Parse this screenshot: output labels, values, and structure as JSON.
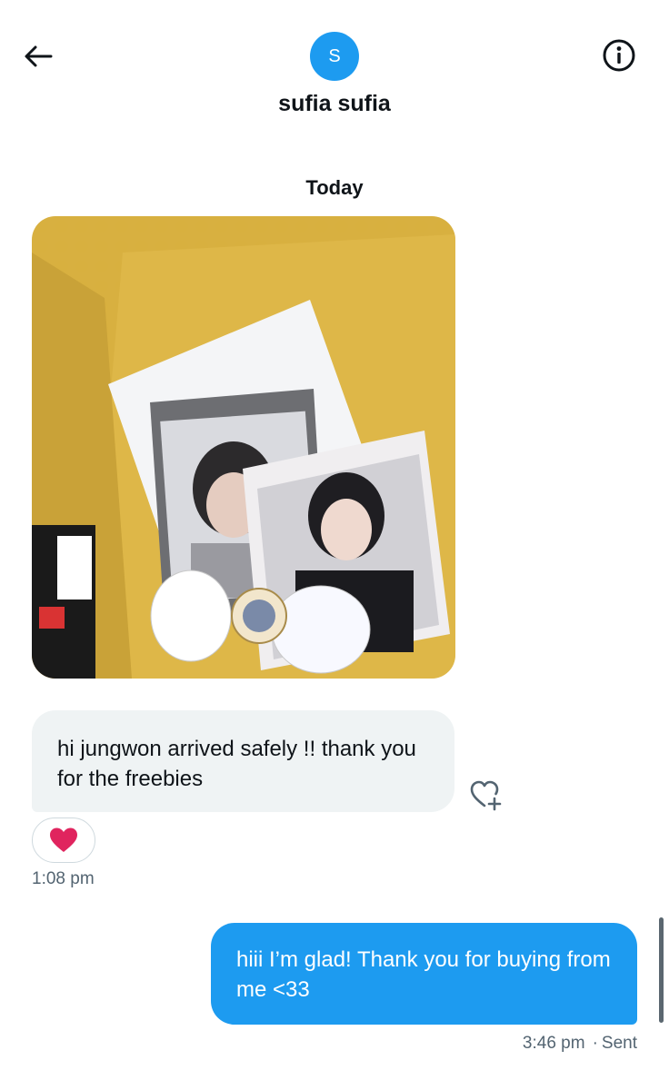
{
  "header": {
    "avatar_letter": "S",
    "name": "sufia sufia"
  },
  "conversation": {
    "date_label": "Today",
    "messages": [
      {
        "direction": "received",
        "text": "hi jungwon arrived safely !! thank you for the freebies",
        "reaction": "❤️",
        "time": "1:08 pm"
      },
      {
        "direction": "sent",
        "text": "hiii I’m glad! Thank you for buying from me <33",
        "time": "3:46 pm",
        "status": "Sent"
      }
    ]
  },
  "colors": {
    "accent": "#1d9bf0",
    "received_bubble": "#eff3f4",
    "secondary_text": "#536471",
    "heart": "#e0245e"
  },
  "icons": {
    "back": "arrow-left-icon",
    "info": "info-icon",
    "react": "heart-plus-icon"
  }
}
